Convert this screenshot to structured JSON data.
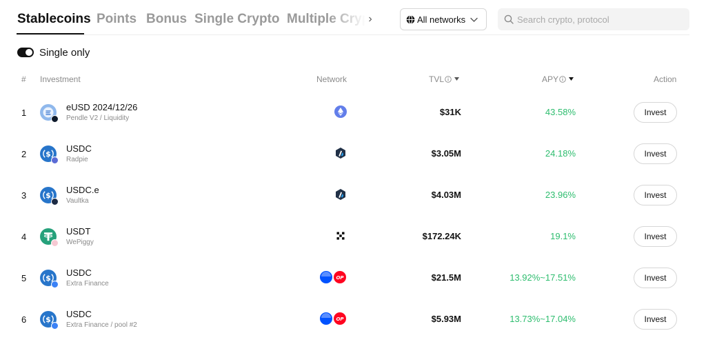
{
  "tabs": [
    "Stablecoins",
    "Points",
    "Bonus",
    "Single Crypto",
    "Multiple Cryp"
  ],
  "filters": {
    "network_select": "All networks",
    "search_placeholder": "Search crypto, protocol",
    "single_only_label": "Single only",
    "single_only_on": true
  },
  "table": {
    "headers": {
      "index": "#",
      "investment": "Investment",
      "network": "Network",
      "tvl": "TVL",
      "apy": "APY",
      "action": "Action"
    },
    "invest_label": "Invest",
    "rows": [
      {
        "index": "1",
        "name": "eUSD 2024/12/26",
        "protocol": "Pendle V2 / Liquidity",
        "networks": [
          "ethereum-icon"
        ],
        "tvl": "$31K",
        "apy": "43.58%",
        "token_icon": "eusd-token-icon",
        "protocol_icon": "pendle-icon"
      },
      {
        "index": "2",
        "name": "USDC",
        "protocol": "Radpie",
        "networks": [
          "arbitrum-icon"
        ],
        "tvl": "$3.05M",
        "apy": "24.18%",
        "token_icon": "usdc-token-icon",
        "protocol_icon": "radpie-icon"
      },
      {
        "index": "3",
        "name": "USDC.e",
        "protocol": "Vaultka",
        "networks": [
          "arbitrum-icon"
        ],
        "tvl": "$4.03M",
        "apy": "23.96%",
        "token_icon": "usdc-token-icon",
        "protocol_icon": "vaultka-icon"
      },
      {
        "index": "4",
        "name": "USDT",
        "protocol": "WePiggy",
        "networks": [
          "okx-icon"
        ],
        "tvl": "$172.24K",
        "apy": "19.1%",
        "token_icon": "usdt-token-icon",
        "protocol_icon": "wepiggy-icon"
      },
      {
        "index": "5",
        "name": "USDC",
        "protocol": "Extra Finance",
        "networks": [
          "base-icon",
          "optimism-icon"
        ],
        "tvl": "$21.5M",
        "apy": "13.92%~17.51%",
        "token_icon": "usdc-token-icon",
        "protocol_icon": "extra-finance-icon"
      },
      {
        "index": "6",
        "name": "USDC",
        "protocol": "Extra Finance / pool #2",
        "networks": [
          "base-icon",
          "optimism-icon"
        ],
        "tvl": "$5.93M",
        "apy": "13.73%~17.04%",
        "token_icon": "usdc-token-icon",
        "protocol_icon": "extra-finance-icon"
      }
    ]
  },
  "colors": {
    "accent": "#121212",
    "apy_green": "#2dbd6e",
    "muted": "#8a8a8a",
    "usdc_blue": "#2775ca",
    "usdt_green": "#26a17b",
    "optimism_red": "#ff0420",
    "base_blue": "#0052ff",
    "ethereum_purple": "#627eea"
  }
}
